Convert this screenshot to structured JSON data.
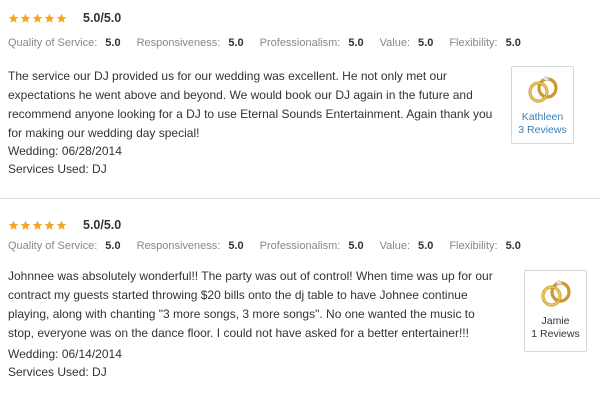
{
  "reviews": [
    {
      "rating": "5.0/5.0",
      "stars": 5,
      "metrics": [
        {
          "label": "Quality of Service:",
          "value": "5.0"
        },
        {
          "label": "Responsiveness:",
          "value": "5.0"
        },
        {
          "label": "Professionalism:",
          "value": "5.0"
        },
        {
          "label": "Value:",
          "value": "5.0"
        },
        {
          "label": "Flexibility:",
          "value": "5.0"
        }
      ],
      "text": "The service our DJ provided us for our wedding was excellent. He not only met our expectations he went above and beyond. We would book our DJ again in the future and recommend anyone looking for a DJ to use Eternal Sounds Entertainment. Again thank you for making our wedding day special!",
      "wedding": "Wedding: 06/28/2014",
      "services": "Services Used: DJ",
      "reviewer": {
        "name": "Kathleen",
        "reviews": "3 Reviews",
        "icon": "wedding-rings-icon"
      }
    },
    {
      "rating": "5.0/5.0",
      "stars": 5,
      "metrics": [
        {
          "label": "Quality of Service:",
          "value": "5.0"
        },
        {
          "label": "Responsiveness:",
          "value": "5.0"
        },
        {
          "label": "Professionalism:",
          "value": "5.0"
        },
        {
          "label": "Value:",
          "value": "5.0"
        },
        {
          "label": "Flexibility:",
          "value": "5.0"
        }
      ],
      "text": "Johnnee was absolutely wonderful!! The party was out of control! When time was up for our contract my guests started throwing $20 bills onto the dj table to have Johnee continue playing, along with chanting \"3 more songs, 3 more songs\". No one wanted the music to stop, everyone was on the dance floor. I could not have asked for a better entertainer!!!",
      "wedding": "Wedding: 06/14/2014",
      "services": "Services Used: DJ",
      "reviewer": {
        "name": "Jamie",
        "reviews": "1 Reviews",
        "icon": "wedding-rings-icon"
      }
    }
  ],
  "colors": {
    "star": "#f5a623",
    "link": "#3b7fb8",
    "label": "#888888",
    "ring": "#d4a93a"
  }
}
